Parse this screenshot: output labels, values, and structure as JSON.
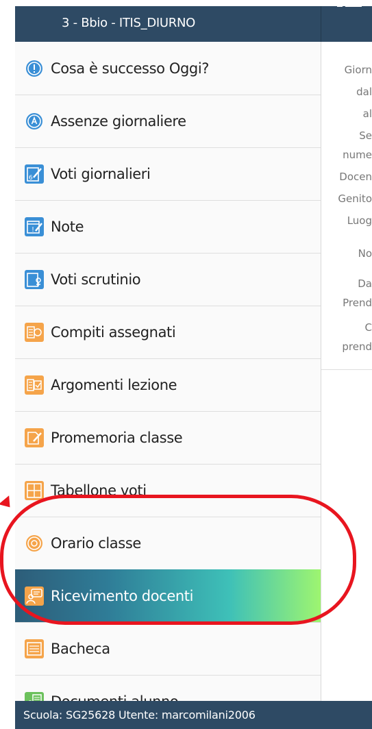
{
  "header": {
    "class_title": "3 - Bbio - ITIS_DIURNO"
  },
  "menu": {
    "items": [
      {
        "label": "Cosa è successo Oggi?",
        "icon": "info-circle-icon",
        "color": "#3a8fd6"
      },
      {
        "label": "Assenze giornaliere",
        "icon": "absence-circle-icon",
        "color": "#3a8fd6"
      },
      {
        "label": "Voti giornalieri",
        "icon": "grades-icon",
        "color": "#3a8fd6"
      },
      {
        "label": "Note",
        "icon": "notes-icon",
        "color": "#3a8fd6"
      },
      {
        "label": "Voti scrutinio",
        "icon": "scrutiny-icon",
        "color": "#3a8fd6"
      },
      {
        "label": "Compiti assegnati",
        "icon": "homework-icon",
        "color": "#f5a44a"
      },
      {
        "label": "Argomenti lezione",
        "icon": "lesson-topics-icon",
        "color": "#f5a44a"
      },
      {
        "label": "Promemoria classe",
        "icon": "reminder-icon",
        "color": "#f5a44a"
      },
      {
        "label": "Tabellone voti",
        "icon": "grades-board-icon",
        "color": "#f5a44a"
      },
      {
        "label": "Orario classe",
        "icon": "timetable-icon",
        "color": "#f5a44a"
      },
      {
        "label": "Ricevimento docenti",
        "icon": "teacher-meeting-icon",
        "color": "#f5a44a",
        "selected": true
      },
      {
        "label": "Bacheca",
        "icon": "noticeboard-icon",
        "color": "#f5a44a"
      },
      {
        "label": "Documenti alunno",
        "icon": "student-documents-icon",
        "color": "#6cc15c"
      }
    ]
  },
  "right_panel": {
    "lines": [
      "Giorn",
      "dal",
      "al",
      "Se",
      "nume",
      "Docen",
      "Genito",
      "Luog",
      "No",
      "Da",
      "Prend",
      "C",
      "prend"
    ]
  },
  "footer": {
    "text": "Scuola: SG25628 Utente: marcomilani2006"
  },
  "colors": {
    "header_bg": "#2e4a64",
    "annotation": "#e8151f"
  }
}
